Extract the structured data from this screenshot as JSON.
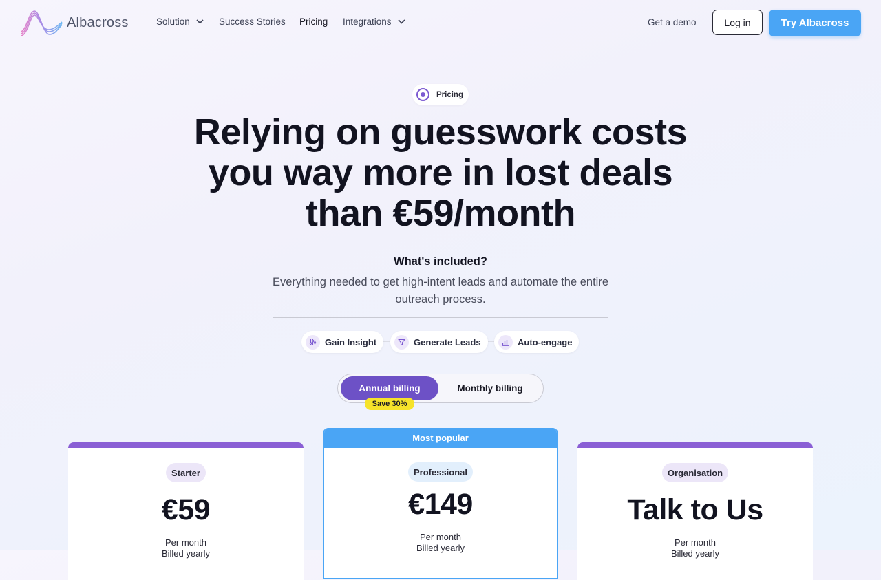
{
  "nav": {
    "logo_text": "Albacross",
    "items": [
      {
        "label": "Solution"
      },
      {
        "label": "Success Stories"
      },
      {
        "label": "Pricing"
      },
      {
        "label": "Integrations"
      }
    ],
    "demo_label": "Get a demo",
    "login_label": "Log in",
    "try_label": "Try Albacross"
  },
  "hero": {
    "tag": "Pricing",
    "headline": "Relying on guesswork costs you way more in lost deals than €59/month",
    "included_title": "What's included?",
    "included_desc": "Everything needed to get high-intent leads and automate the entire outreach process.",
    "features": [
      {
        "label": "Gain Insight",
        "icon": "sliders-icon"
      },
      {
        "label": "Generate Leads",
        "icon": "funnel-icon"
      },
      {
        "label": "Auto-engage",
        "icon": "bar-chart-icon"
      }
    ]
  },
  "billing": {
    "annual": "Annual billing",
    "monthly": "Monthly billing",
    "selected": "annual",
    "save_badge": "Save 30%"
  },
  "plans": [
    {
      "name": "Starter",
      "price": "€59",
      "per": "Per month",
      "billed": "Billed yearly"
    },
    {
      "name": "Professional",
      "price": "€149",
      "per": "Per month",
      "billed": "Billed yearly",
      "badge": "Most popular"
    },
    {
      "name": "Organisation",
      "price": "Talk to Us",
      "per": "Per month",
      "billed": "Billed yearly"
    }
  ],
  "colors": {
    "accent_purple": "#6d51c6",
    "accent_blue": "#4aa5f5",
    "save_yellow": "#f6e32a"
  }
}
